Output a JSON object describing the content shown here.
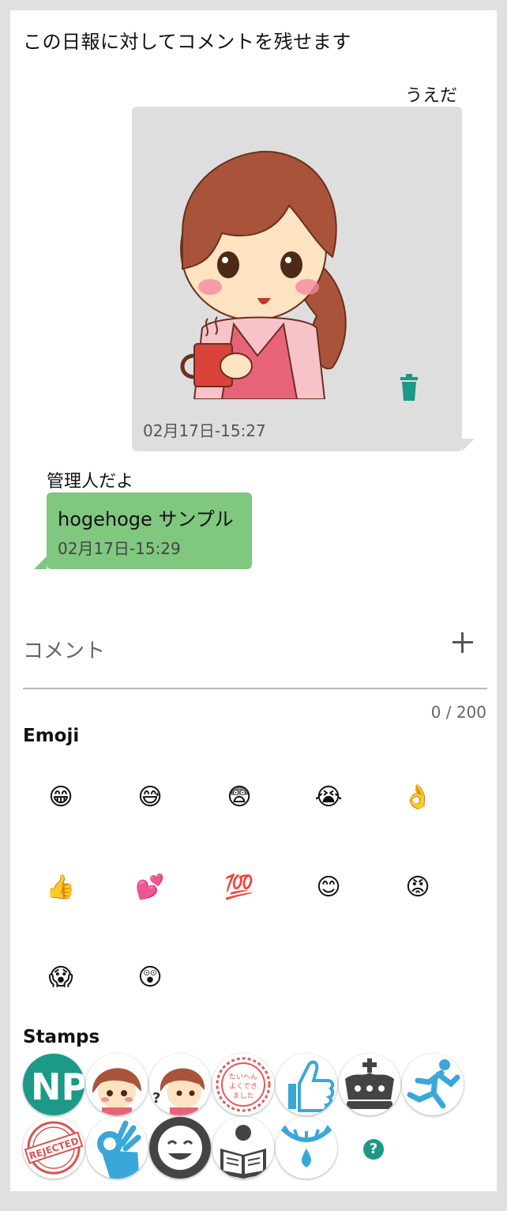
{
  "header": {
    "title": "この日報に対してコメントを残せます"
  },
  "comments": [
    {
      "author": "うえだ",
      "type": "stamp",
      "stamp_icon": "girl-holding-coffee-stamp",
      "time": "02月17日-15:27",
      "bubble_color": "#dedede"
    },
    {
      "author": "管理人だよ",
      "type": "text",
      "message": "hogehoge サンプル",
      "time": "02月17日-15:29",
      "bubble_color": "#80c77f"
    }
  ],
  "comment_input": {
    "placeholder": "コメント",
    "counter": "0 / 200"
  },
  "emoji_section": {
    "title": "Emoji",
    "items": [
      "😁",
      "😅",
      "😨",
      "😭",
      "👌",
      "👍",
      "💕",
      "💯",
      "😊",
      "😡",
      "😱",
      "😲"
    ]
  },
  "stamps_section": {
    "title": "Stamps",
    "items": [
      "np-logo-stamp",
      "girl-thinking-stamp",
      "girl-question-stamp",
      "taihen-yoku-dekimashita-stamp",
      "thumbs-up-stamp",
      "crown-stamp",
      "running-man-stamp",
      "rejected-stamp",
      "ok-hand-stamp",
      "smiling-face-stamp",
      "reading-person-stamp",
      "crying-eye-stamp"
    ],
    "rejected_text": "REJECTED",
    "seal_text": "たいへん よくでき ました",
    "help_label": "?"
  },
  "colors": {
    "accent": "#1c9987",
    "stamp_blue": "#3aa7d9",
    "dark_gray": "#444444"
  }
}
